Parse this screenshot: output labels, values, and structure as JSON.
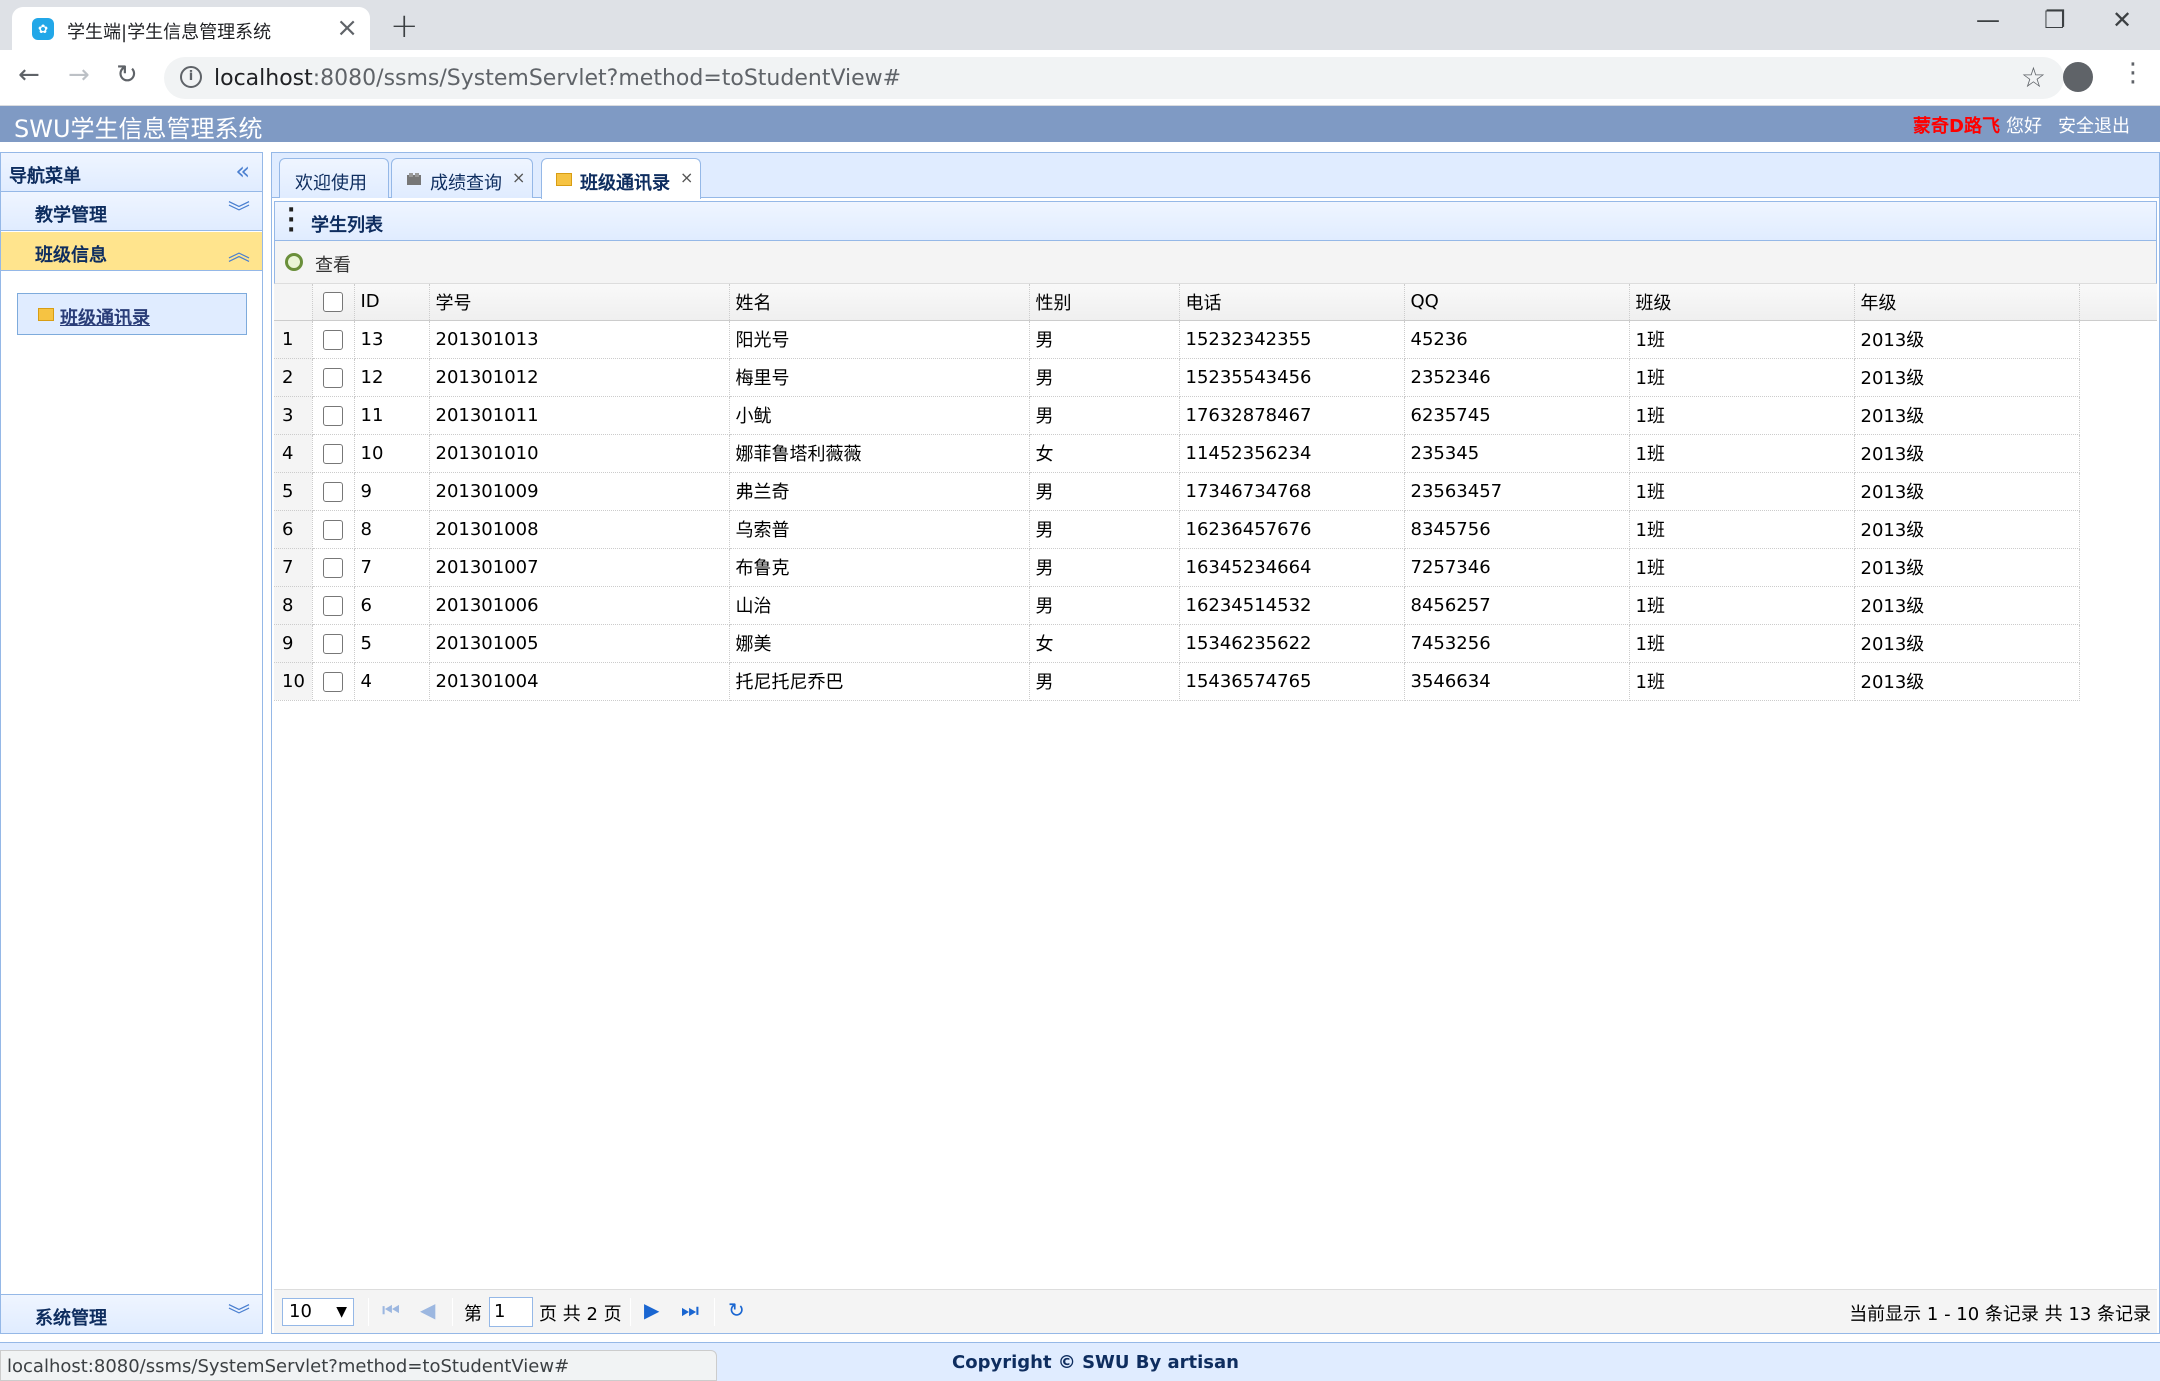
{
  "browser": {
    "tab_title": "学生端|学生信息管理系统",
    "url_host": "localhost",
    "url_rest": ":8080/ssms/SystemServlet?method=toStudentView#",
    "status_url": "localhost:8080/ssms/SystemServlet?method=toStudentView#"
  },
  "header": {
    "brand": "SWU学生信息管理系统",
    "user": "蒙奇D路飞",
    "greeting": "您好",
    "logout": "安全退出"
  },
  "sidebar": {
    "title": "导航菜单",
    "sections": [
      {
        "label": "教学管理"
      },
      {
        "label": "班级信息"
      },
      {
        "label": "系统管理"
      }
    ],
    "item": "班级通讯录"
  },
  "tabs": [
    {
      "label": "欢迎使用"
    },
    {
      "label": "成绩查询"
    },
    {
      "label": "班级通讯录"
    }
  ],
  "grid": {
    "title": "学生列表",
    "tool_view": "查看",
    "columns": [
      "ID",
      "学号",
      "姓名",
      "性别",
      "电话",
      "QQ",
      "班级",
      "年级"
    ],
    "rows": [
      [
        "1",
        "13",
        "201301013",
        "阳光号",
        "男",
        "15232342355",
        "45236",
        "1班",
        "2013级"
      ],
      [
        "2",
        "12",
        "201301012",
        "梅里号",
        "男",
        "15235543456",
        "2352346",
        "1班",
        "2013级"
      ],
      [
        "3",
        "11",
        "201301011",
        "小鱿",
        "男",
        "17632878467",
        "6235745",
        "1班",
        "2013级"
      ],
      [
        "4",
        "10",
        "201301010",
        "娜菲鲁塔利薇薇",
        "女",
        "11452356234",
        "235345",
        "1班",
        "2013级"
      ],
      [
        "5",
        "9",
        "201301009",
        "弗兰奇",
        "男",
        "17346734768",
        "23563457",
        "1班",
        "2013级"
      ],
      [
        "6",
        "8",
        "201301008",
        "乌索普",
        "男",
        "16236457676",
        "8345756",
        "1班",
        "2013级"
      ],
      [
        "7",
        "7",
        "201301007",
        "布鲁克",
        "男",
        "16345234664",
        "7257346",
        "1班",
        "2013级"
      ],
      [
        "8",
        "6",
        "201301006",
        "山治",
        "男",
        "16234514532",
        "8456257",
        "1班",
        "2013级"
      ],
      [
        "9",
        "5",
        "201301005",
        "娜美",
        "女",
        "15346235622",
        "7453256",
        "1班",
        "2013级"
      ],
      [
        "10",
        "4",
        "201301004",
        "托尼托尼乔巴",
        "男",
        "15436574765",
        "3546634",
        "1班",
        "2013级"
      ]
    ]
  },
  "pager": {
    "page_size": "10",
    "page_prefix": "第",
    "page_value": "1",
    "page_suffix": "页 共 2 页",
    "info": "当前显示 1 - 10 条记录 共 13 条记录"
  },
  "footer": {
    "copyright": "Copyright © SWU By artisan"
  }
}
